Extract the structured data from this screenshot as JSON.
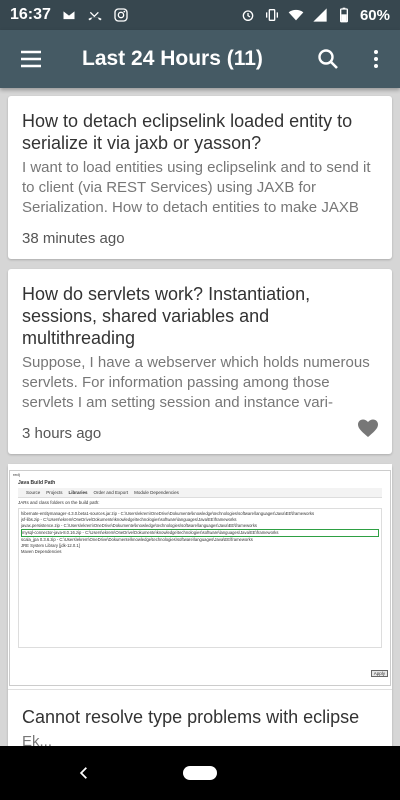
{
  "status": {
    "time": "16:37",
    "battery": "60%",
    "left_icons": [
      "mail-icon",
      "missed-call-icon",
      "instagram-icon"
    ],
    "right_icons": [
      "alarm-icon",
      "vibrate-icon",
      "wifi-icon",
      "signal-icon",
      "battery-icon"
    ]
  },
  "app_bar": {
    "title": "Last 24 Hours (11)",
    "menu_icon": "hamburger-menu-icon",
    "search_icon": "search-icon",
    "more_icon": "more-vert-icon",
    "colors": {
      "bar": "#455a64",
      "status": "#37474f"
    }
  },
  "cards": [
    {
      "title": "How to detach eclipselink loaded entity to serialize it via jaxb or yasson?",
      "excerpt": "I want to load entities using eclipselink and to send it to client (via REST Services) using JAXB for Serialization. How to detach entities to make JAXB",
      "time": "38 minutes ago"
    },
    {
      "title": "How do servlets work? Instantiation, sessions, shared variables and multithreading",
      "excerpt": "Suppose, I have a webserver which holds numerous servlets. For information passing among those servlets I am setting session and instance vari-",
      "time": "3 hours ago",
      "favorite_icon": "heart-icon"
    }
  ],
  "image_card": {
    "screenshot": {
      "window_label": "red)",
      "title": "Java Build Path",
      "tabs": [
        "Source",
        "Projects",
        "Libraries",
        "Order and Export",
        "Module Dependencies"
      ],
      "subtitle": "JARs and class folders on the build path:",
      "rows": [
        "hibernate-entitymanager-4.3.0.beta1-sources.jar.zip - C:\\Users\\ekrem\\OneDrive\\Dokumente\\knowledge\\technologies\\software\\languages\\Java\\EE\\frameworks",
        "jsf-libs.zip - C:\\Users\\ekrem\\OneDrive\\Dokumente\\knowledge\\technologies\\software\\languages\\Java\\EE\\frameworks",
        "javax.persistence.zip - C:\\Users\\ekrem\\OneDrive\\Dokumente\\knowledge\\technologies\\software\\languages\\Java\\EE\\frameworks",
        "mysql-connector-java-8.0.16.zip - C:\\Users\\ekrem\\OneDrive\\Dokumente\\knowledge\\technologies\\software\\languages\\Java\\EE\\frameworks",
        "scala_jpa 0.3.6.zip - C:\\Users\\ekrem\\OneDrive\\Dokumente\\knowledge\\technologies\\software\\languages\\Java\\EE\\frameworks",
        "JRE System Library [jdk-12.0.1]",
        "Maven Dependencies"
      ],
      "apply_label": "Apply"
    },
    "title": "Cannot resolve type problems with eclipse",
    "excerpt_partial": "Ek..."
  },
  "nav": {
    "back_icon": "back-icon",
    "home_icon": "home-pill-icon"
  }
}
